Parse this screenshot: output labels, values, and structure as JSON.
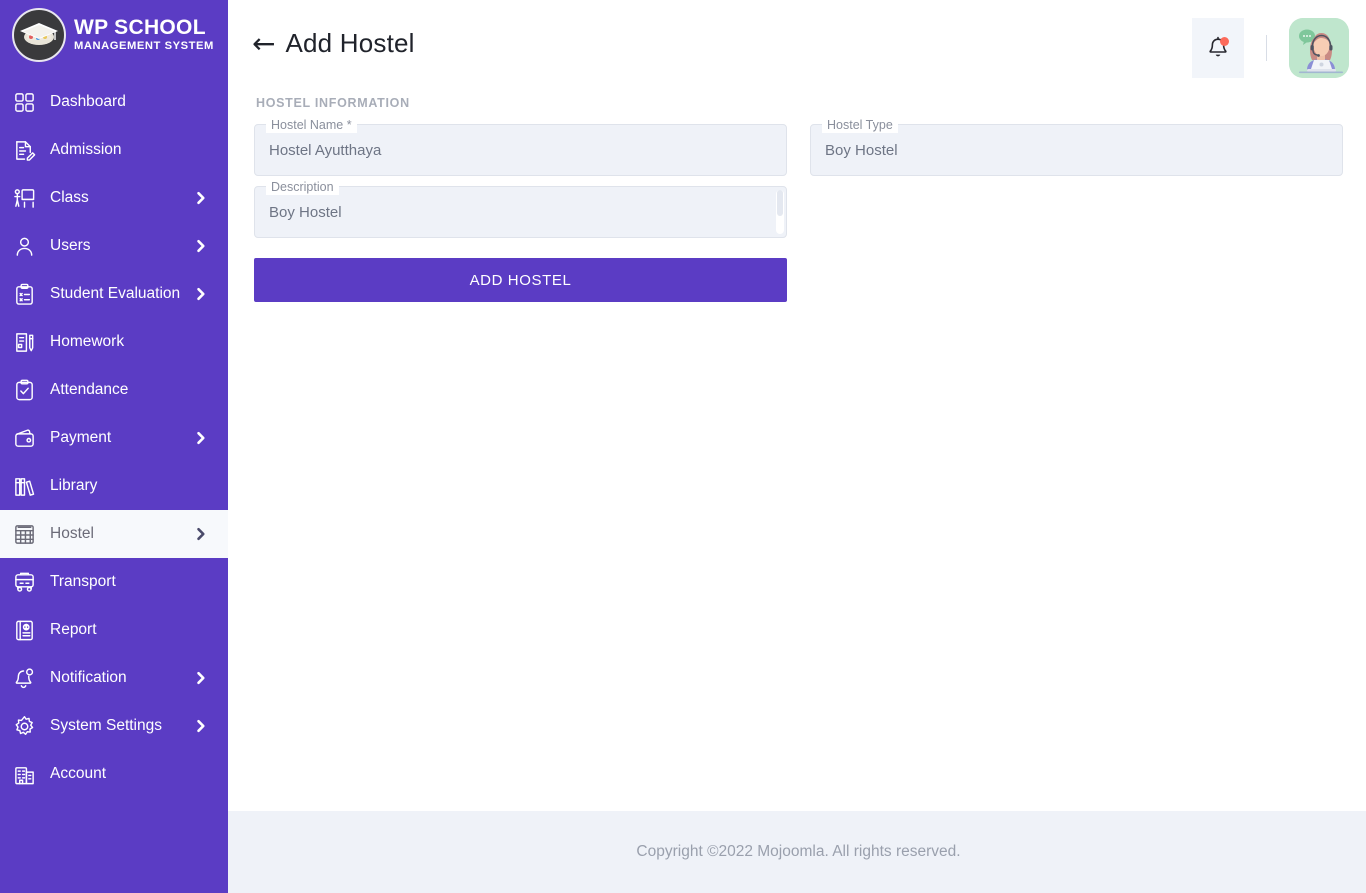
{
  "brand": {
    "logo_icon": "graduation-cap-logo",
    "title": "WP SCHOOL",
    "subtitle": "MANAGEMENT SYSTEM"
  },
  "sidebar": {
    "items": [
      {
        "label": "Dashboard",
        "icon": "grid-icon",
        "caret": false,
        "active": false
      },
      {
        "label": "Admission",
        "icon": "document-edit-icon",
        "caret": false,
        "active": false
      },
      {
        "label": "Class",
        "icon": "teacher-board-icon",
        "caret": true,
        "active": false
      },
      {
        "label": "Users",
        "icon": "user-icon",
        "caret": true,
        "active": false
      },
      {
        "label": "Student Evaluation",
        "icon": "clipboard-check-icon",
        "caret": true,
        "active": false
      },
      {
        "label": "Homework",
        "icon": "book-pencil-icon",
        "caret": false,
        "active": false
      },
      {
        "label": "Attendance",
        "icon": "clipboard-tick-icon",
        "caret": false,
        "active": false
      },
      {
        "label": "Payment",
        "icon": "wallet-icon",
        "caret": true,
        "active": false
      },
      {
        "label": "Library",
        "icon": "books-icon",
        "caret": false,
        "active": false
      },
      {
        "label": "Hostel",
        "icon": "hostel-building-icon",
        "caret": true,
        "active": true
      },
      {
        "label": "Transport",
        "icon": "bus-icon",
        "caret": false,
        "active": false
      },
      {
        "label": "Report",
        "icon": "report-icon",
        "caret": false,
        "active": false
      },
      {
        "label": "Notification",
        "icon": "bell-icon",
        "caret": true,
        "active": false
      },
      {
        "label": "System Settings",
        "icon": "gear-icon",
        "caret": true,
        "active": false
      },
      {
        "label": "Account",
        "icon": "building-icon",
        "caret": false,
        "active": false
      }
    ]
  },
  "header": {
    "back_arrow": "←",
    "title": "Add Hostel",
    "notification_icon": "bell-icon",
    "notification_has_badge": true,
    "avatar_icon": "support-agent-avatar"
  },
  "main": {
    "section_label": "HOSTEL INFORMATION",
    "fields": [
      {
        "name": "hostel-name",
        "label": "Hostel Name *",
        "value": "Hostel Ayutthaya",
        "placeholder": "Hostel Name",
        "type": "text"
      },
      {
        "name": "hostel-type",
        "label": "Hostel Type",
        "value": "Boy Hostel",
        "placeholder": "Hostel Type",
        "type": "text"
      },
      {
        "name": "description",
        "label": "Description",
        "value": "Boy Hostel",
        "placeholder": "Description",
        "type": "textarea"
      }
    ],
    "submit_label": "ADD HOSTEL"
  },
  "footer": {
    "text": "Copyright ©2022 Mojoomla. All rights reserved."
  },
  "colors": {
    "brand_purple": "#5b3cc4",
    "field_fill": "#eff2f8",
    "footer_bg": "#eff2f8",
    "badge_red": "#fc6a5a",
    "avatar_bg": "#bfe6cd",
    "active_item_bg": "#f7f9fc"
  }
}
